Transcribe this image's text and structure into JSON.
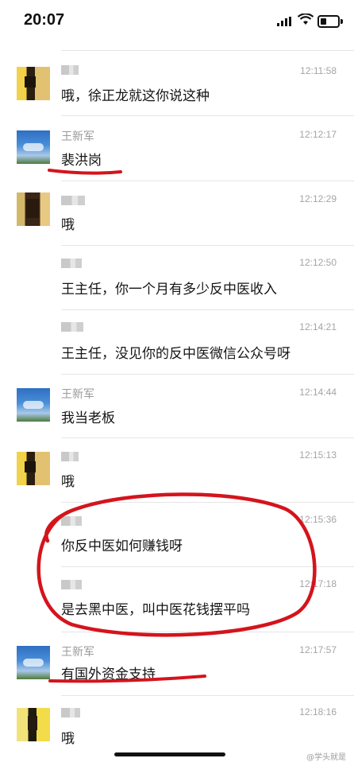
{
  "status_bar": {
    "time": "20:07"
  },
  "messages": [
    {
      "name": "",
      "time": "12:11:58",
      "text": "哦，徐正龙就这你说这种"
    },
    {
      "name": "王新军",
      "time": "12:12:17",
      "text": "裴洪岗"
    },
    {
      "name": "",
      "time": "12:12:29",
      "text": "哦"
    },
    {
      "name": "",
      "time": "12:12:50",
      "text": "王主任，你一个月有多少反中医收入"
    },
    {
      "name": "",
      "time": "12:14:21",
      "text": "王主任，没见你的反中医微信公众号呀"
    },
    {
      "name": "王新军",
      "time": "12:14:44",
      "text": "我当老板"
    },
    {
      "name": "",
      "time": "12:15:13",
      "text": "哦"
    },
    {
      "name": "",
      "time": "12:15:36",
      "text": "你反中医如何赚钱呀"
    },
    {
      "name": "",
      "time": "12:17:18",
      "text": "是去黑中医，叫中医花钱摆平吗"
    },
    {
      "name": "王新军",
      "time": "12:17:57",
      "text": "有国外资金支持"
    },
    {
      "name": "",
      "time": "12:18:16",
      "text": "哦"
    }
  ],
  "watermark": "@学头就是",
  "colors": {
    "annotation": "#d4141c"
  }
}
